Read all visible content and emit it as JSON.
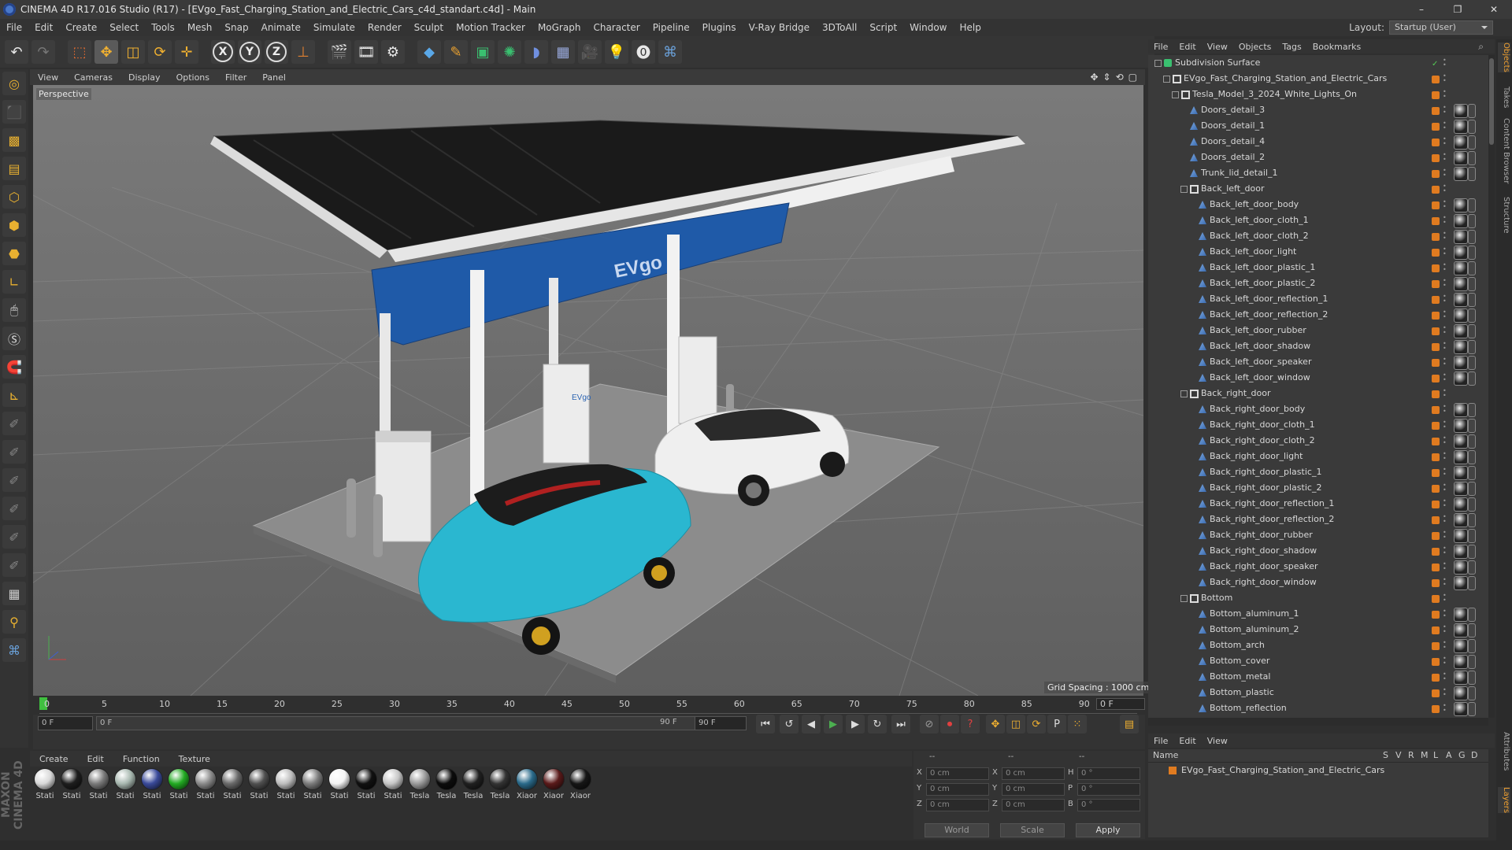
{
  "window": {
    "title": "CINEMA 4D R17.016 Studio (R17) - [EVgo_Fast_Charging_Station_and_Electric_Cars_c4d_standart.c4d] - Main",
    "controls": [
      "–",
      "❐",
      "✕"
    ]
  },
  "menubar": {
    "items": [
      "File",
      "Edit",
      "Create",
      "Select",
      "Tools",
      "Mesh",
      "Snap",
      "Animate",
      "Simulate",
      "Render",
      "Sculpt",
      "Motion Tracker",
      "MoGraph",
      "Character",
      "Pipeline",
      "Plugins",
      "V-Ray Bridge",
      "3DToAll",
      "Script",
      "Window",
      "Help"
    ],
    "layout_label": "Layout:",
    "layout_value": "Startup (User)"
  },
  "toolbar": {
    "axis_labels": [
      "X",
      "Y",
      "Z"
    ]
  },
  "viewport": {
    "menu": [
      "View",
      "Cameras",
      "Display",
      "Options",
      "Filter",
      "Panel"
    ],
    "label": "Perspective",
    "grid_spacing": "Grid Spacing : 1000 cm",
    "canopy_logo": "EVgo",
    "charger_logo": "EVgo"
  },
  "timeline": {
    "ticks": [
      "0",
      "5",
      "10",
      "15",
      "20",
      "25",
      "30",
      "35",
      "40",
      "45",
      "50",
      "55",
      "60",
      "65",
      "70",
      "75",
      "80",
      "85",
      "90"
    ],
    "current_frame_right": "0 F",
    "start_field": "0 F",
    "range_start": "0 F",
    "range_end": "90 F",
    "end_field": "90 F"
  },
  "materials": {
    "menu": [
      "Create",
      "Edit",
      "Function",
      "Texture"
    ],
    "items": [
      {
        "label": "Stati",
        "color": "#d8d8d8"
      },
      {
        "label": "Stati",
        "color": "#1e1e1e"
      },
      {
        "label": "Stati",
        "color": "#7a7a7a"
      },
      {
        "label": "Stati",
        "color": "#a8b8b0"
      },
      {
        "label": "Stati",
        "color": "#3a4a9a"
      },
      {
        "label": "Stati",
        "color": "#22aa22"
      },
      {
        "label": "Stati",
        "color": "#8a8a8a"
      },
      {
        "label": "Stati",
        "color": "#6a6a6a"
      },
      {
        "label": "Stati",
        "color": "#505050"
      },
      {
        "label": "Stati",
        "color": "#bdbdbd"
      },
      {
        "label": "Stati",
        "color": "#7c7c7c"
      },
      {
        "label": "Stati",
        "color": "#f4f4f4"
      },
      {
        "label": "Stati",
        "color": "#111111"
      },
      {
        "label": "Stati",
        "color": "#c6c6c6"
      },
      {
        "label": "Tesla",
        "color": "#9a9a9a"
      },
      {
        "label": "Tesla",
        "color": "#0c0c0c"
      },
      {
        "label": "Tesla",
        "color": "#202020"
      },
      {
        "label": "Tesla",
        "color": "#333333"
      },
      {
        "label": "Xiaor",
        "color": "#2a6a8a"
      },
      {
        "label": "Xiaor",
        "color": "#5a1a1a"
      },
      {
        "label": "Xiaor",
        "color": "#161616"
      }
    ]
  },
  "coords": {
    "header_dashes": [
      "--",
      "--",
      "--"
    ],
    "rows": [
      {
        "a": "X",
        "av": "0 cm",
        "b": "X",
        "bv": "0 cm",
        "c": "H",
        "cv": "0 °"
      },
      {
        "a": "Y",
        "av": "0 cm",
        "b": "Y",
        "bv": "0 cm",
        "c": "P",
        "cv": "0 °"
      },
      {
        "a": "Z",
        "av": "0 cm",
        "b": "Z",
        "bv": "0 cm",
        "c": "B",
        "cv": "0 °"
      }
    ],
    "mode": "World",
    "transform": "Scale",
    "apply": "Apply"
  },
  "objects_panel": {
    "menu": [
      "File",
      "Edit",
      "View",
      "Objects",
      "Tags",
      "Bookmarks"
    ],
    "rows": [
      {
        "name": "Subdivision Surface",
        "indent": 0,
        "type": "subdiv",
        "tag": false
      },
      {
        "name": "EVgo_Fast_Charging_Station_and_Electric_Cars",
        "indent": 1,
        "type": "null",
        "tag": false
      },
      {
        "name": "Tesla_Model_3_2024_White_Lights_On",
        "indent": 2,
        "type": "null",
        "tag": false
      },
      {
        "name": "Doors_detail_3",
        "indent": 3,
        "type": "poly",
        "tag": true
      },
      {
        "name": "Doors_detail_1",
        "indent": 3,
        "type": "poly",
        "tag": true
      },
      {
        "name": "Doors_detail_4",
        "indent": 3,
        "type": "poly",
        "tag": true
      },
      {
        "name": "Doors_detail_2",
        "indent": 3,
        "type": "poly",
        "tag": true
      },
      {
        "name": "Trunk_lid_detail_1",
        "indent": 3,
        "type": "poly",
        "tag": true
      },
      {
        "name": "Back_left_door",
        "indent": 3,
        "type": "null",
        "tag": false
      },
      {
        "name": "Back_left_door_body",
        "indent": 4,
        "type": "poly",
        "tag": true
      },
      {
        "name": "Back_left_door_cloth_1",
        "indent": 4,
        "type": "poly",
        "tag": true
      },
      {
        "name": "Back_left_door_cloth_2",
        "indent": 4,
        "type": "poly",
        "tag": true
      },
      {
        "name": "Back_left_door_light",
        "indent": 4,
        "type": "poly",
        "tag": true
      },
      {
        "name": "Back_left_door_plastic_1",
        "indent": 4,
        "type": "poly",
        "tag": true
      },
      {
        "name": "Back_left_door_plastic_2",
        "indent": 4,
        "type": "poly",
        "tag": true
      },
      {
        "name": "Back_left_door_reflection_1",
        "indent": 4,
        "type": "poly",
        "tag": true
      },
      {
        "name": "Back_left_door_reflection_2",
        "indent": 4,
        "type": "poly",
        "tag": true
      },
      {
        "name": "Back_left_door_rubber",
        "indent": 4,
        "type": "poly",
        "tag": true
      },
      {
        "name": "Back_left_door_shadow",
        "indent": 4,
        "type": "poly",
        "tag": true
      },
      {
        "name": "Back_left_door_speaker",
        "indent": 4,
        "type": "poly",
        "tag": true
      },
      {
        "name": "Back_left_door_window",
        "indent": 4,
        "type": "poly",
        "tag": true
      },
      {
        "name": "Back_right_door",
        "indent": 3,
        "type": "null",
        "tag": false
      },
      {
        "name": "Back_right_door_body",
        "indent": 4,
        "type": "poly",
        "tag": true
      },
      {
        "name": "Back_right_door_cloth_1",
        "indent": 4,
        "type": "poly",
        "tag": true
      },
      {
        "name": "Back_right_door_cloth_2",
        "indent": 4,
        "type": "poly",
        "tag": true
      },
      {
        "name": "Back_right_door_light",
        "indent": 4,
        "type": "poly",
        "tag": true
      },
      {
        "name": "Back_right_door_plastic_1",
        "indent": 4,
        "type": "poly",
        "tag": true
      },
      {
        "name": "Back_right_door_plastic_2",
        "indent": 4,
        "type": "poly",
        "tag": true
      },
      {
        "name": "Back_right_door_reflection_1",
        "indent": 4,
        "type": "poly",
        "tag": true
      },
      {
        "name": "Back_right_door_reflection_2",
        "indent": 4,
        "type": "poly",
        "tag": true
      },
      {
        "name": "Back_right_door_rubber",
        "indent": 4,
        "type": "poly",
        "tag": true
      },
      {
        "name": "Back_right_door_shadow",
        "indent": 4,
        "type": "poly",
        "tag": true
      },
      {
        "name": "Back_right_door_speaker",
        "indent": 4,
        "type": "poly",
        "tag": true
      },
      {
        "name": "Back_right_door_window",
        "indent": 4,
        "type": "poly",
        "tag": true
      },
      {
        "name": "Bottom",
        "indent": 3,
        "type": "null",
        "tag": false
      },
      {
        "name": "Bottom_aluminum_1",
        "indent": 4,
        "type": "poly",
        "tag": true
      },
      {
        "name": "Bottom_aluminum_2",
        "indent": 4,
        "type": "poly",
        "tag": true
      },
      {
        "name": "Bottom_arch",
        "indent": 4,
        "type": "poly",
        "tag": true
      },
      {
        "name": "Bottom_cover",
        "indent": 4,
        "type": "poly",
        "tag": true
      },
      {
        "name": "Bottom_metal",
        "indent": 4,
        "type": "poly",
        "tag": true
      },
      {
        "name": "Bottom_plastic",
        "indent": 4,
        "type": "poly",
        "tag": true
      },
      {
        "name": "Bottom_reflection",
        "indent": 4,
        "type": "poly",
        "tag": true
      }
    ]
  },
  "layers_panel": {
    "menu": [
      "File",
      "Edit",
      "View"
    ],
    "header_name": "Name",
    "header_cols": [
      "S",
      "V",
      "R",
      "M",
      "L",
      "A",
      "G",
      "D"
    ],
    "rows": [
      {
        "name": "EVgo_Fast_Charging_Station_and_Electric_Cars"
      }
    ]
  },
  "side_tabs": [
    "Objects",
    "Takes",
    "Content Browser",
    "Structure",
    "Attributes",
    "Layers"
  ],
  "colors": {
    "accent": "#e07b20",
    "canopy_blue": "#1f5aa8",
    "car_cyan": "#2ab7d0"
  }
}
